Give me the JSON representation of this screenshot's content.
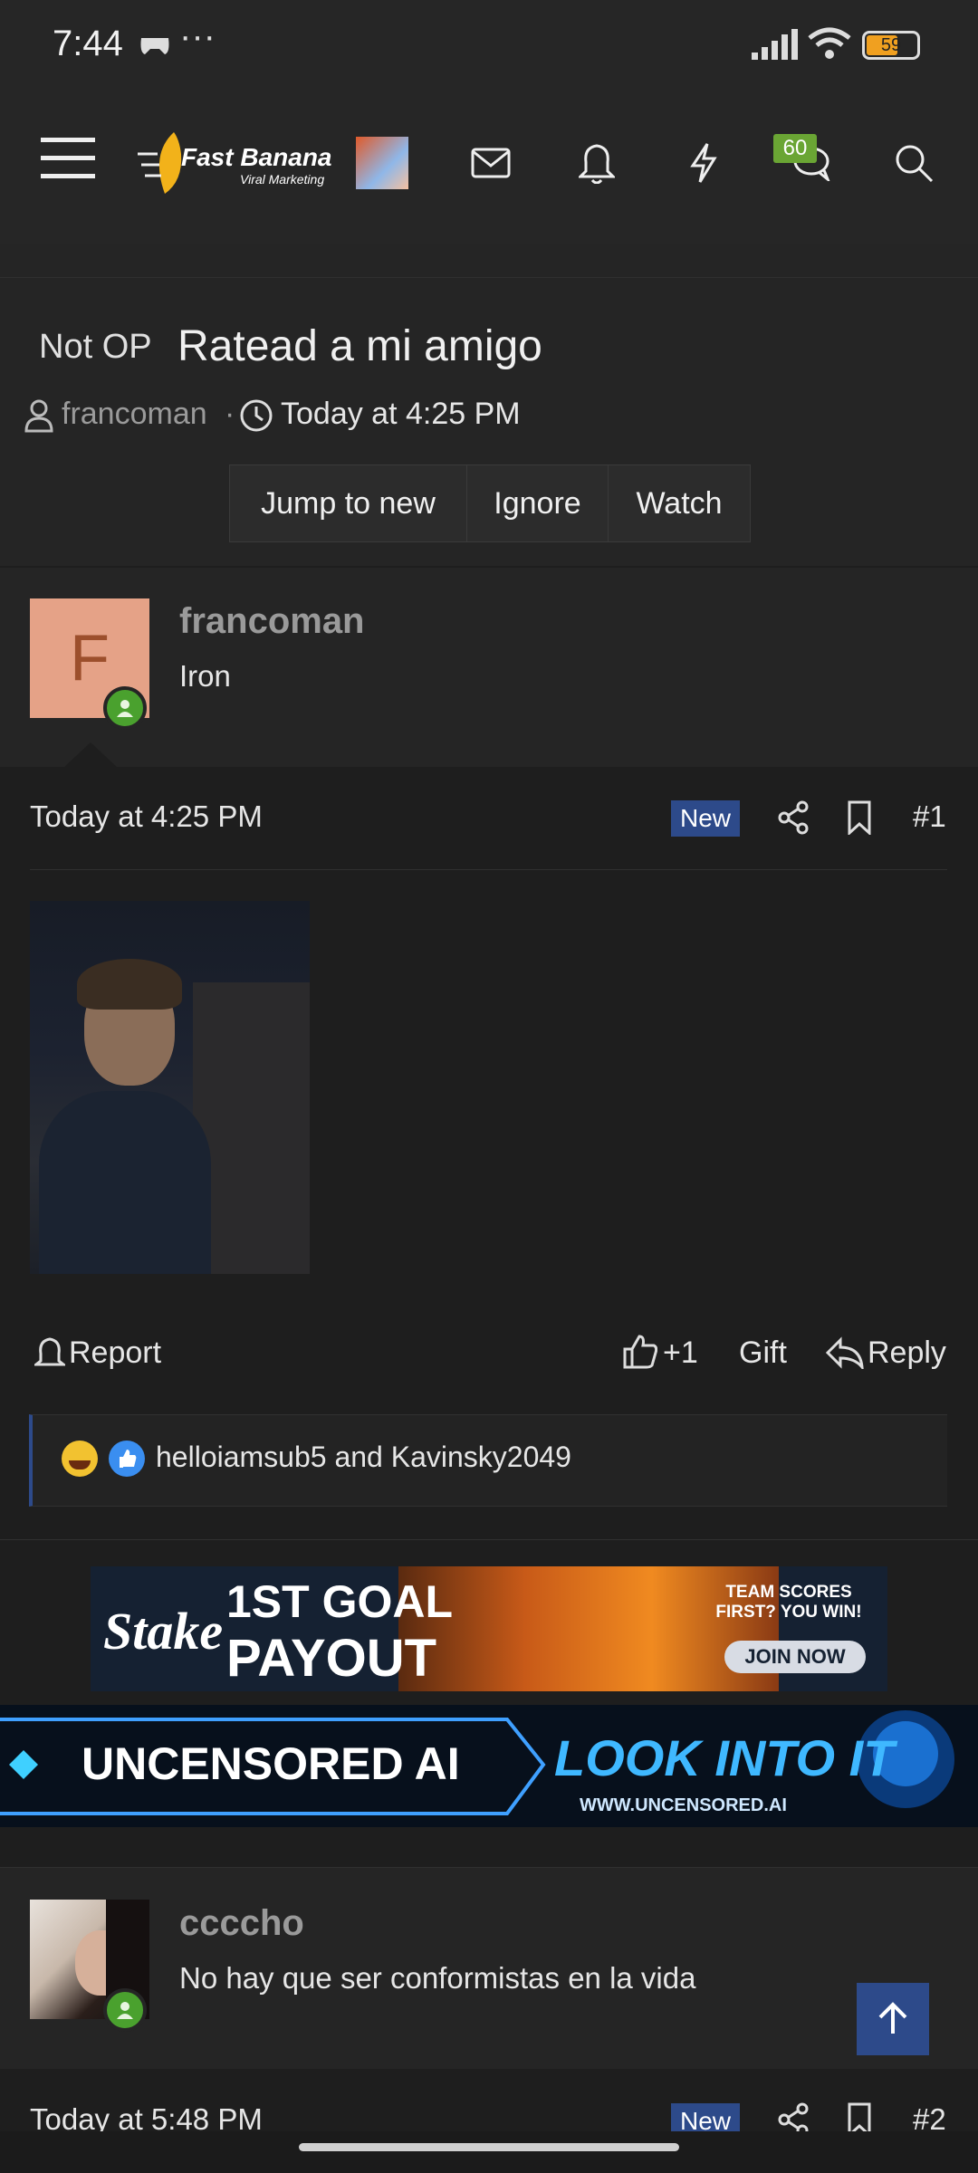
{
  "status_bar": {
    "time": "7:44",
    "dots": "···",
    "battery": "59"
  },
  "top_nav": {
    "logo_text": "Fast Banana",
    "logo_subtext": "Viral Marketing",
    "chat_badge": "60",
    "icons": [
      "menu-icon",
      "avatar",
      "mail-icon",
      "bell-icon",
      "lightning-icon",
      "chat-icon",
      "search-icon"
    ]
  },
  "thread": {
    "prefix": "Not OP",
    "title": "Ratead a mi amigo",
    "author": "francoman",
    "separator": "·",
    "time": "Today at 4:25 PM",
    "buttons": [
      "Jump to new",
      "Ignore",
      "Watch"
    ]
  },
  "posts": [
    {
      "avatar_letter": "F",
      "username": "francoman",
      "rank": "Iron",
      "time": "Today at 4:25 PM",
      "badge": "New",
      "number": "#1",
      "actions": {
        "report": "Report",
        "like": "+1",
        "gift": "Gift",
        "reply": "Reply"
      },
      "reactions_text": "helloiamsub5 and Kavinsky2049"
    },
    {
      "username": "ccccho",
      "rank": "No hay que ser conformistas en la vida",
      "time": "Today at 5:48 PM",
      "badge": "New",
      "number": "#2"
    }
  ],
  "ads": {
    "stake": {
      "brand": "Stake",
      "headline_1": "1ST GOAL",
      "headline_2": "PAYOUT",
      "tag": "TEAM SCORES FIRST? YOU WIN!",
      "cta": "JOIN NOW"
    },
    "uncensored": {
      "text": "UNCENSORED AI",
      "cta": "LOOK INTO IT",
      "url": "WWW.UNCENSORED.AI"
    }
  },
  "colors": {
    "accent_blue": "#2d4a8a",
    "online_green": "#4aa12e",
    "badge_green": "#6aa534",
    "avatar_bg": "#e5a287"
  }
}
